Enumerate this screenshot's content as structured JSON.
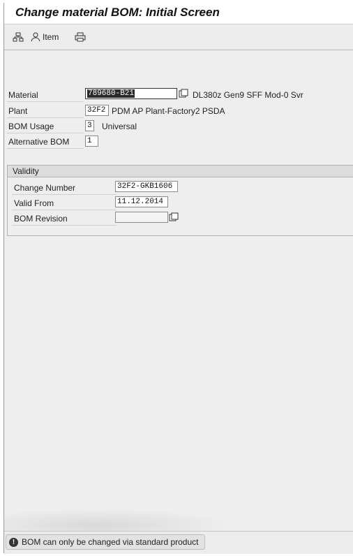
{
  "window": {
    "title": "Change material BOM: Initial Screen"
  },
  "toolbar": {
    "item_label": "Item"
  },
  "fields": {
    "material": {
      "label": "Material",
      "value": "789680-B21",
      "description": "DL380z Gen9 SFF Mod-0 Svr"
    },
    "plant": {
      "label": "Plant",
      "value": "32F2",
      "description": "PDM AP Plant-Factory2  PSDA"
    },
    "bom_usage": {
      "label": "BOM Usage",
      "value": "3",
      "description": "Universal"
    },
    "alternative_bom": {
      "label": "Alternative BOM",
      "value": "1"
    }
  },
  "validity": {
    "title": "Validity",
    "change_number": {
      "label": "Change Number",
      "value": "32F2-GKB1606"
    },
    "valid_from": {
      "label": "Valid From",
      "value": "11.12.2014"
    },
    "bom_revision": {
      "label": "BOM Revision",
      "value": ""
    }
  },
  "status": {
    "message": "BOM can only be changed via standard product",
    "icon": "warning-icon"
  }
}
